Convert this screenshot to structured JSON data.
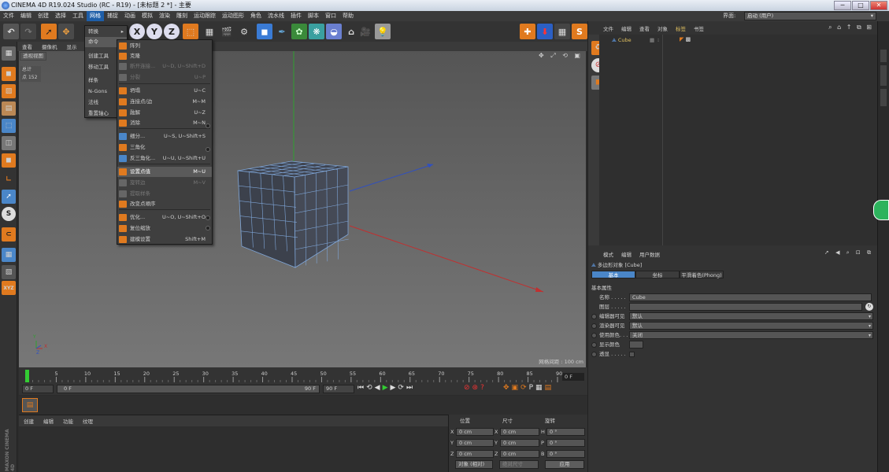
{
  "window": {
    "title": "CINEMA 4D R19.024 Studio (RC - R19) - [未标题 2 *] - 主要",
    "minimize": "─",
    "maximize": "□",
    "close": "✕"
  },
  "menubar": {
    "items": [
      "文件",
      "编辑",
      "创建",
      "选择",
      "工具",
      "网格",
      "捕捉",
      "动画",
      "模拟",
      "渲染",
      "雕刻",
      "运动跟踪",
      "运动图形",
      "角色",
      "流水线",
      "插件",
      "脚本",
      "窗口",
      "帮助"
    ],
    "interface_label": "界面:",
    "interface_value": "启动 (用户)"
  },
  "mesh_menu": {
    "items": [
      {
        "label": "转换",
        "arrow": "▸"
      },
      {
        "label": "命令",
        "arrow": "▸"
      },
      {
        "label": "创建工具",
        "arrow": "▸"
      },
      {
        "label": "移动工具",
        "arrow": "▸"
      },
      {
        "label": "样条",
        "arrow": "▸"
      },
      {
        "label": "N-Gons",
        "arrow": "▸"
      },
      {
        "label": "法线",
        "arrow": "▸"
      },
      {
        "label": "重置轴心",
        "arrow": "▸"
      }
    ]
  },
  "command_submenu": {
    "items": [
      {
        "label": "阵列",
        "shortcut": "",
        "disabled": false
      },
      {
        "label": "克隆",
        "shortcut": "",
        "disabled": false
      },
      {
        "label": "断开连接...",
        "shortcut": "U~D, U~Shift+D",
        "disabled": true
      },
      {
        "label": "分裂",
        "shortcut": "U~P",
        "disabled": true
      },
      {
        "label": "坍塌",
        "shortcut": "U~C",
        "disabled": false
      },
      {
        "label": "连接点/边",
        "shortcut": "M~M",
        "disabled": false
      },
      {
        "label": "融解",
        "shortcut": "U~Z",
        "disabled": false
      },
      {
        "label": "消除",
        "shortcut": "M~N",
        "disabled": false
      },
      {
        "label": "细分...",
        "shortcut": "U~S, U~Shift+S",
        "disabled": false
      },
      {
        "label": "三角化",
        "shortcut": "",
        "disabled": false
      },
      {
        "label": "反三角化...",
        "shortcut": "U~U, U~Shift+U",
        "disabled": false
      },
      {
        "label": "设置点值",
        "shortcut": "M~U",
        "disabled": false
      },
      {
        "label": "旋转边",
        "shortcut": "M~V",
        "disabled": true
      },
      {
        "label": "提取样条",
        "shortcut": "",
        "disabled": true
      },
      {
        "label": "改变点顺序",
        "shortcut": "",
        "disabled": false
      },
      {
        "label": "优化...",
        "shortcut": "U~O, U~Shift+O",
        "disabled": false
      },
      {
        "label": "复位缩放",
        "shortcut": "",
        "disabled": false
      },
      {
        "label": "建模设置",
        "shortcut": "Shift+M",
        "disabled": false
      }
    ]
  },
  "viewport": {
    "menu": [
      "查看",
      "摄像机",
      "显示"
    ],
    "view_name": "透视视图",
    "hud_label": "总计",
    "hud_key": "点",
    "hud_value": "152",
    "grid_spacing": "网格间距 : 100 cm",
    "nav_icons": "✥ ⤢ ⟲ ▣",
    "axis_x": "X",
    "axis_y": "Y",
    "axis_z": "Z"
  },
  "timeline": {
    "ticks": [
      "0",
      "5",
      "10",
      "15",
      "20",
      "25",
      "30",
      "35",
      "40",
      "45",
      "50",
      "55",
      "60",
      "65",
      "70",
      "75",
      "80",
      "85",
      "90"
    ],
    "end_label": "0 F",
    "start_field": "0 F",
    "range_start": "0 F",
    "range_end": "90 F",
    "end_field": "90 F"
  },
  "material_panel": {
    "menu": [
      "创建",
      "编辑",
      "功能",
      "纹理"
    ]
  },
  "coord_panel": {
    "headers": [
      "位置",
      "尺寸",
      "旋转"
    ],
    "rows": [
      {
        "axis": "X",
        "pos": "0 cm",
        "size_axis": "X",
        "size": "0 cm",
        "rot_axis": "H",
        "rot": "0 °"
      },
      {
        "axis": "Y",
        "pos": "0 cm",
        "size_axis": "Y",
        "size": "0 cm",
        "rot_axis": "P",
        "rot": "0 °"
      },
      {
        "axis": "Z",
        "pos": "0 cm",
        "size_axis": "Z",
        "size": "0 cm",
        "rot_axis": "B",
        "rot": "0 °"
      }
    ],
    "mode_select": "对象 (相对)",
    "size_select": "绝对尺寸",
    "apply": "应用"
  },
  "object_manager": {
    "menu": [
      "文件",
      "编辑",
      "查看",
      "对象",
      "标签",
      "书签"
    ],
    "object_name": "Cube"
  },
  "attributes": {
    "menu": [
      "模式",
      "编辑",
      "用户数据"
    ],
    "object_type": "多边形对象 [Cube]",
    "tabs": [
      "基本",
      "坐标",
      "平滑着色(Phong)"
    ],
    "section": "基本属性",
    "rows": [
      {
        "label": "名称 . . . . .",
        "value": "Cube"
      },
      {
        "label": "图层 . . . . .",
        "value": ""
      },
      {
        "label": "编辑器可见",
        "value": "默认"
      },
      {
        "label": "渲染器可见",
        "value": "默认"
      },
      {
        "label": "使用颜色. . .",
        "value": "关闭"
      },
      {
        "label": "显示颜色",
        "value": ""
      },
      {
        "label": "透显 . . . . .",
        "value": ""
      }
    ]
  },
  "maxon_logo": "MAXON CINEMA 4D",
  "colors": {
    "accent": "#1e5ea8",
    "toolbar_blue": "#3a7bd5",
    "orange": "#e07a1f",
    "cube_edge": "#7fa6d8"
  }
}
